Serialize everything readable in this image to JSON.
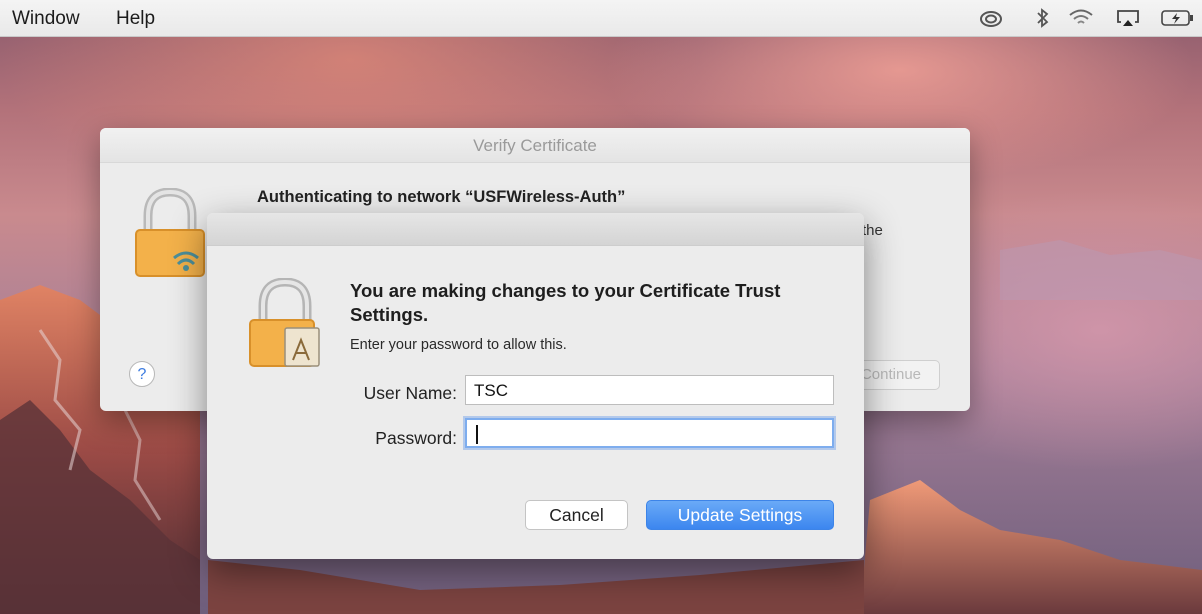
{
  "menubar": {
    "items": [
      "Window",
      "Help"
    ],
    "status_icons": [
      "creative-cloud-icon",
      "bluetooth-icon",
      "wifi-icon",
      "airplay-icon",
      "battery-charging-icon"
    ]
  },
  "back_window": {
    "title": "Verify Certificate",
    "heading": "Authenticating to network “USFWireless-Auth”",
    "trailing_text": "the",
    "help_label": "?",
    "continue_label": "Continue"
  },
  "auth_dialog": {
    "title": "You are making changes to your Certificate Trust Settings.",
    "subtitle": "Enter your password to allow this.",
    "username_label": "User Name:",
    "username_value": "TSC",
    "password_label": "Password:",
    "password_value": "",
    "cancel_label": "Cancel",
    "update_label": "Update Settings"
  },
  "colors": {
    "accent": "#3c86ef",
    "focus_ring": "#7eadee"
  }
}
